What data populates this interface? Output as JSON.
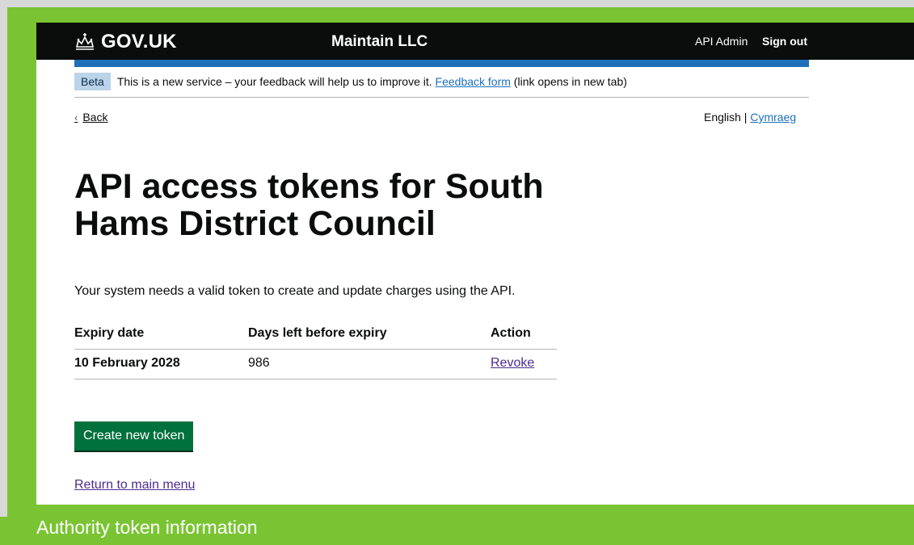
{
  "header": {
    "logo_text": "GOV.UK",
    "service_name": "Maintain LLC",
    "nav": {
      "api_admin": "API Admin",
      "sign_out": "Sign out"
    }
  },
  "beta_banner": {
    "tag": "Beta",
    "text_before": "This is a new service – your feedback will help us to improve it. ",
    "link": "Feedback form",
    "text_after": " (link opens in new tab)"
  },
  "back_link": "Back",
  "language": {
    "english": "English",
    "separator": " | ",
    "welsh": "Cymraeg"
  },
  "page_title": "API access tokens for South Hams District Council",
  "intro": "Your system needs a valid token to create and update charges using the API.",
  "table": {
    "headers": [
      "Expiry date",
      "Days left before expiry",
      "Action"
    ],
    "rows": [
      {
        "expiry_date": "10 February 2028",
        "days_left": "986",
        "action": "Revoke"
      }
    ]
  },
  "create_button": "Create new token",
  "return_link": "Return to main menu",
  "caption": "Authority token information",
  "colors": {
    "header_bg": "#0b0c0c",
    "brand_blue": "#1d70b8",
    "button_green": "#00703c",
    "link_visited": "#4c2c92",
    "outer_green": "#7ac433"
  }
}
